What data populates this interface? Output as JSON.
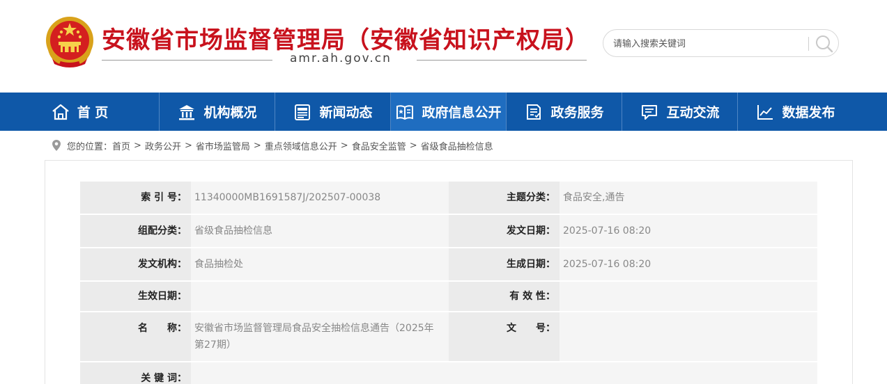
{
  "header": {
    "site_title": "安徽省市场监督管理局（安徽省知识产权局）",
    "domain": "amr.ah.gov.cn",
    "emblem_icon": "national-emblem-icon",
    "search": {
      "placeholder": "请输入搜索关键词",
      "icon": "search-icon"
    }
  },
  "colors": {
    "title_red": "#c8121d",
    "nav_blue": "#0f58a8",
    "nav_active": "#1f6dc0"
  },
  "nav": {
    "items": [
      {
        "label": "首 页",
        "icon": "home-icon"
      },
      {
        "label": "机构概况",
        "icon": "institution-icon"
      },
      {
        "label": "新闻动态",
        "icon": "news-icon"
      },
      {
        "label": "政府信息公开",
        "icon": "open-book-icon",
        "active": true
      },
      {
        "label": "政务服务",
        "icon": "service-form-icon"
      },
      {
        "label": "互动交流",
        "icon": "chat-icon"
      },
      {
        "label": "数据发布",
        "icon": "line-chart-icon"
      }
    ]
  },
  "breadcrumb": {
    "prefix": "您的位置：",
    "items": [
      "首页",
      "政务公开",
      "省市场监管局",
      "重点领域信息公开",
      "食品安全监管",
      "省级食品抽检信息"
    ],
    "separator": ">",
    "icon": "location-pin-icon"
  },
  "meta": {
    "index_label": "索 引 号：",
    "index_value": "11340000MB1691587J/202507-00038",
    "topic_label": "主题分类：",
    "topic_value": "食品安全,通告",
    "group_label": "组配分类：",
    "group_value": "省级食品抽检信息",
    "issue_date_label": "发文日期：",
    "issue_date_value": "2025-07-16 08:20",
    "org_label": "发文机构：",
    "org_value": "食品抽检处",
    "gen_date_label": "生成日期：",
    "gen_date_value": "2025-07-16 08:20",
    "effective_label": "生效日期：",
    "effective_value": "",
    "validity_label": "有 效 性：",
    "validity_value": "",
    "name_label": "名　　称：",
    "name_value": "安徽省市场监督管理局食品安全抽检信息通告（2025年第27期）",
    "docno_label": "文　　号：",
    "docno_value": "",
    "keywords_label": "关 键 词：",
    "keywords_value": ""
  }
}
